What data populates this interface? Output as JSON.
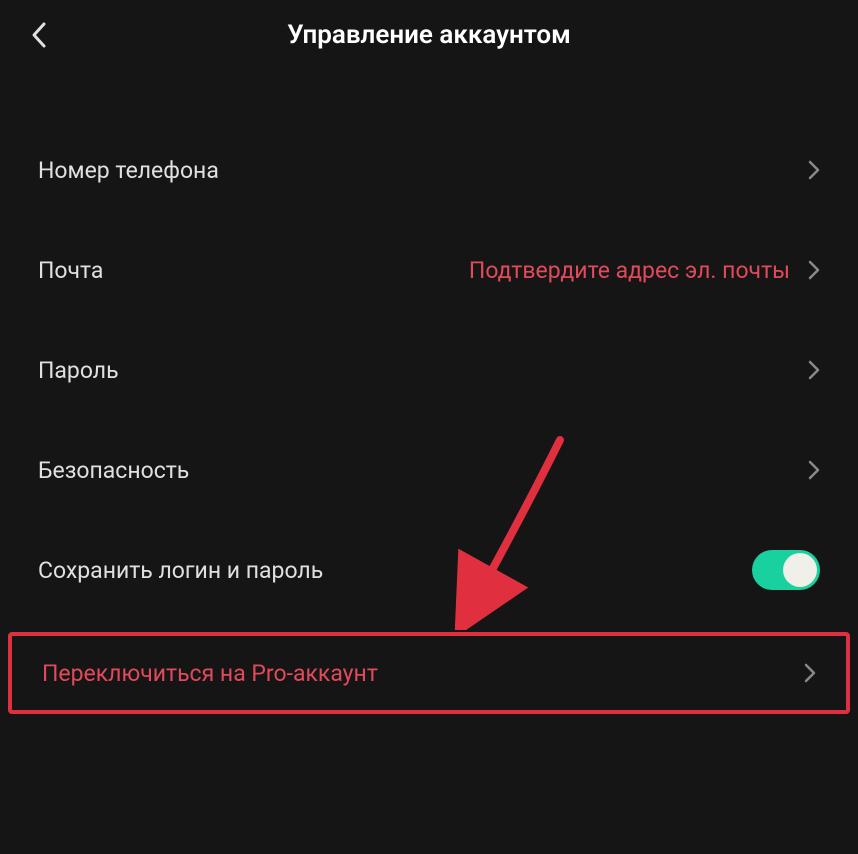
{
  "header": {
    "title": "Управление аккаунтом"
  },
  "rows": {
    "phone": {
      "label": "Номер телефона"
    },
    "email": {
      "label": "Почта",
      "value": "Подтвердите адрес эл. почты"
    },
    "password": {
      "label": "Пароль"
    },
    "security": {
      "label": "Безопасность"
    },
    "save_login": {
      "label": "Сохранить логин и пароль",
      "toggle": true
    },
    "pro_account": {
      "label": "Переключиться на Pro-аккаунт"
    }
  },
  "colors": {
    "accent": "#e14a5a",
    "highlight": "#e03040",
    "toggle_on": "#18d19e",
    "background": "#151515"
  }
}
